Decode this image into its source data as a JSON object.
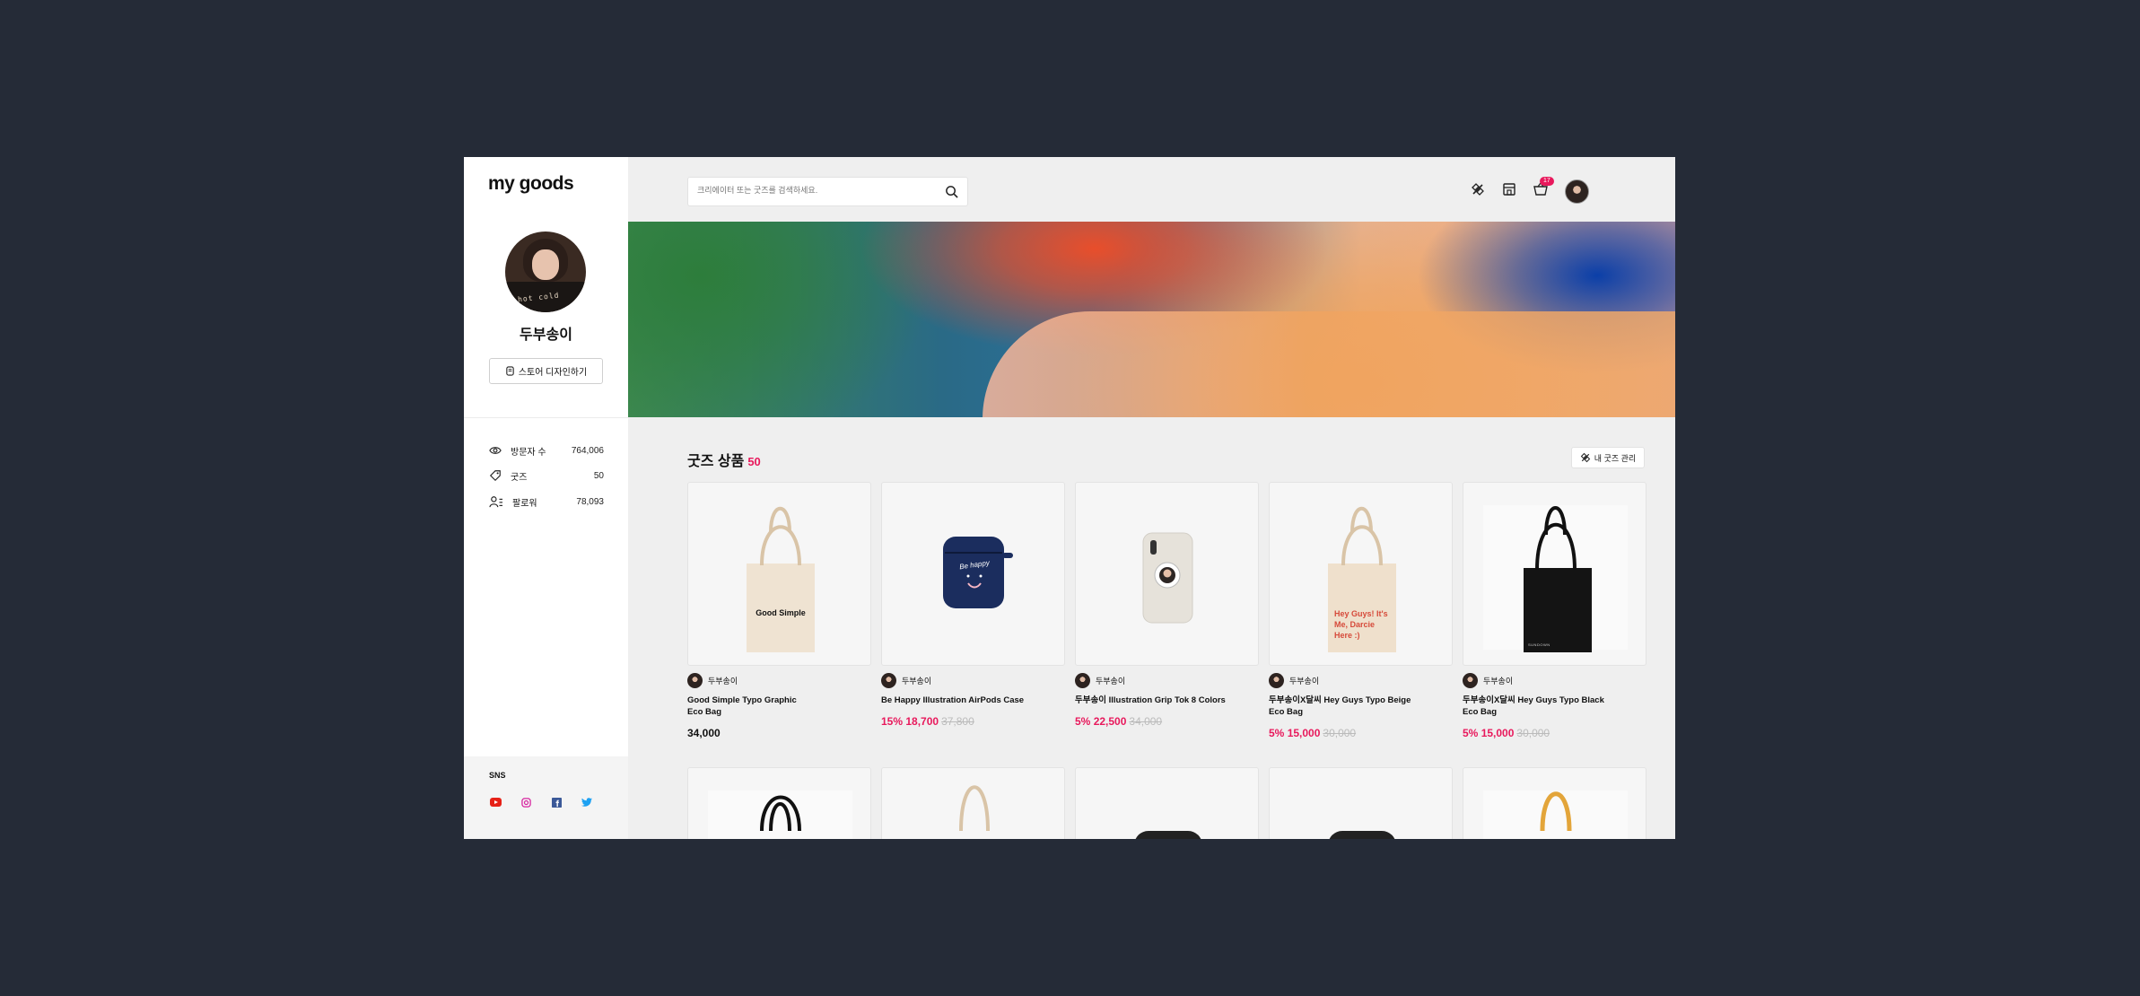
{
  "app": {
    "logo": "my goods"
  },
  "profile": {
    "name": "두부송이",
    "avatar_text": "hot cold",
    "store_button": "스토어 디자인하기"
  },
  "stats": [
    {
      "icon": "eye-icon",
      "label": "방문자 수",
      "value": "764,006"
    },
    {
      "icon": "tag-icon",
      "label": "굿즈",
      "value": "50"
    },
    {
      "icon": "followers-icon",
      "label": "팔로워",
      "value": "78,093"
    }
  ],
  "sns": {
    "title": "SNS",
    "icons": [
      "youtube-icon",
      "instagram-icon",
      "facebook-icon",
      "twitter-icon"
    ]
  },
  "search": {
    "placeholder": "크리에이터 또는 굿즈를 검색하세요."
  },
  "header": {
    "cart_count": "17"
  },
  "goods": {
    "title": "굿즈 상품",
    "count": "50",
    "manage_label": "내 굿즈 관리",
    "items": [
      {
        "seller": "두부송이",
        "name": "Good Simple Typo Graphic Eco Bag",
        "price": "34,000",
        "discount": "",
        "sale_price": "",
        "original_price": "",
        "bag_text": "Good Simple"
      },
      {
        "seller": "두부송이",
        "name": "Be Happy Illustration AirPods Case",
        "price": "",
        "discount": "15%",
        "sale_price": "18,700",
        "original_price": "37,800",
        "case_text": "Be happy"
      },
      {
        "seller": "두부송이",
        "name": "두부송이 Illustration Grip Tok 8 Colors",
        "price": "",
        "discount": "5%",
        "sale_price": "22,500",
        "original_price": "34,000"
      },
      {
        "seller": "두부송이",
        "name": "두부송이X달씨 Hey Guys Typo Beige Eco Bag",
        "price": "",
        "discount": "5%",
        "sale_price": "15,000",
        "original_price": "30,000",
        "bag_text": "Hey Guys! It's Me, Darcie Here :)"
      },
      {
        "seller": "두부송이",
        "name": "두부송이X달씨 Hey Guys Typo Black Eco Bag",
        "price": "",
        "discount": "5%",
        "sale_price": "15,000",
        "original_price": "30,000",
        "bag_text": "SUNDOWN"
      }
    ]
  }
}
